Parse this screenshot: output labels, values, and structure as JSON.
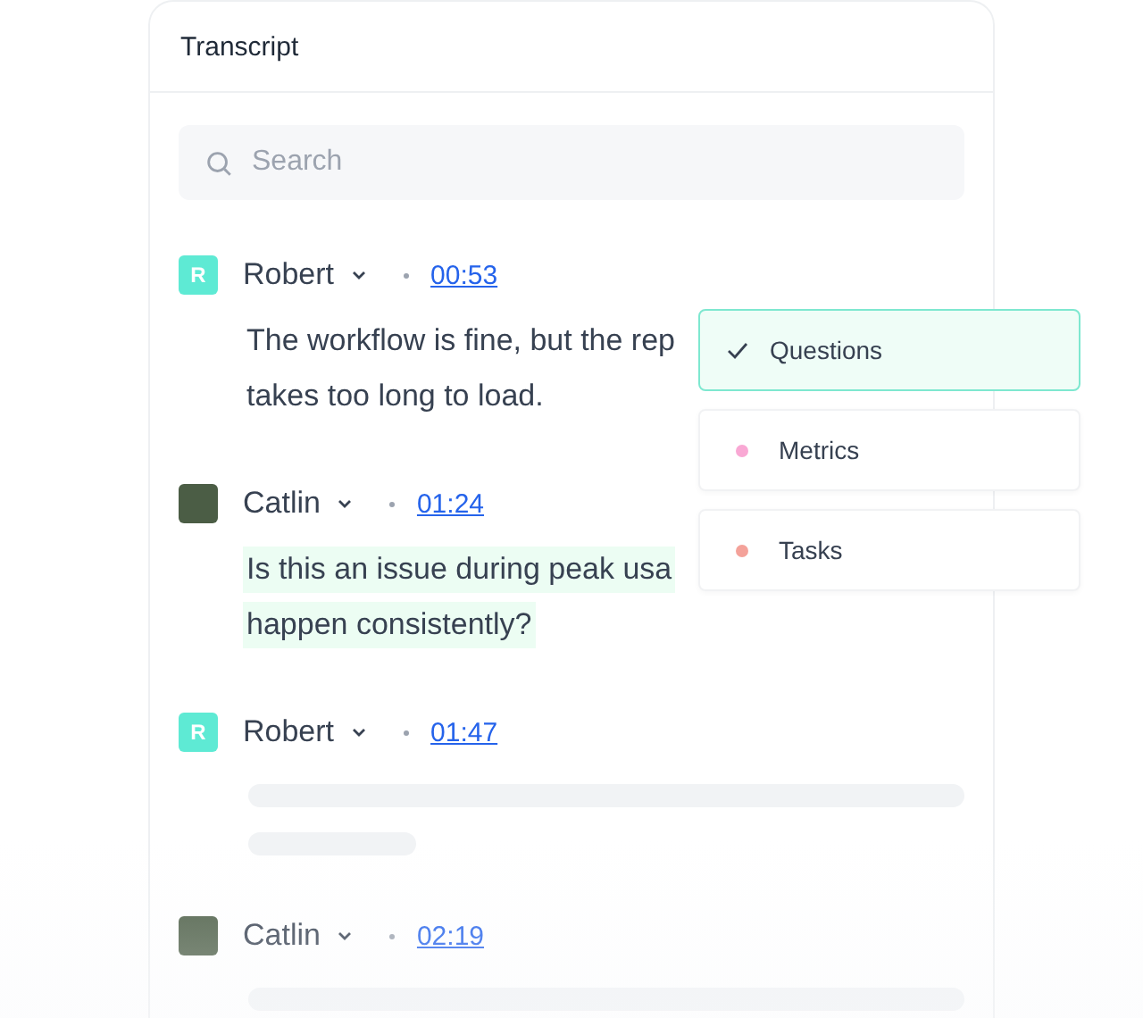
{
  "panel": {
    "title": "Transcript"
  },
  "search": {
    "placeholder": "Search"
  },
  "entries": [
    {
      "speaker": "Robert",
      "avatar": {
        "kind": "initial",
        "text": "R"
      },
      "time": "00:53",
      "kind": "text",
      "highlighted": false,
      "lines": [
        "The workflow is fine, but the rep",
        "takes too long to load."
      ]
    },
    {
      "speaker": "Catlin",
      "avatar": {
        "kind": "photo"
      },
      "time": "01:24",
      "kind": "text",
      "highlighted": true,
      "lines": [
        "Is this an issue during peak usa",
        "happen consistently?"
      ]
    },
    {
      "speaker": "Robert",
      "avatar": {
        "kind": "initial",
        "text": "R"
      },
      "time": "01:47",
      "kind": "skeleton"
    },
    {
      "speaker": "Catlin",
      "avatar": {
        "kind": "photo"
      },
      "time": "02:19",
      "kind": "skeleton"
    }
  ],
  "tags": [
    {
      "label": "Questions",
      "selected": true
    },
    {
      "label": "Metrics",
      "selected": false,
      "color": "#f9a8d4"
    },
    {
      "label": "Tasks",
      "selected": false,
      "color": "#f4a29a"
    }
  ]
}
